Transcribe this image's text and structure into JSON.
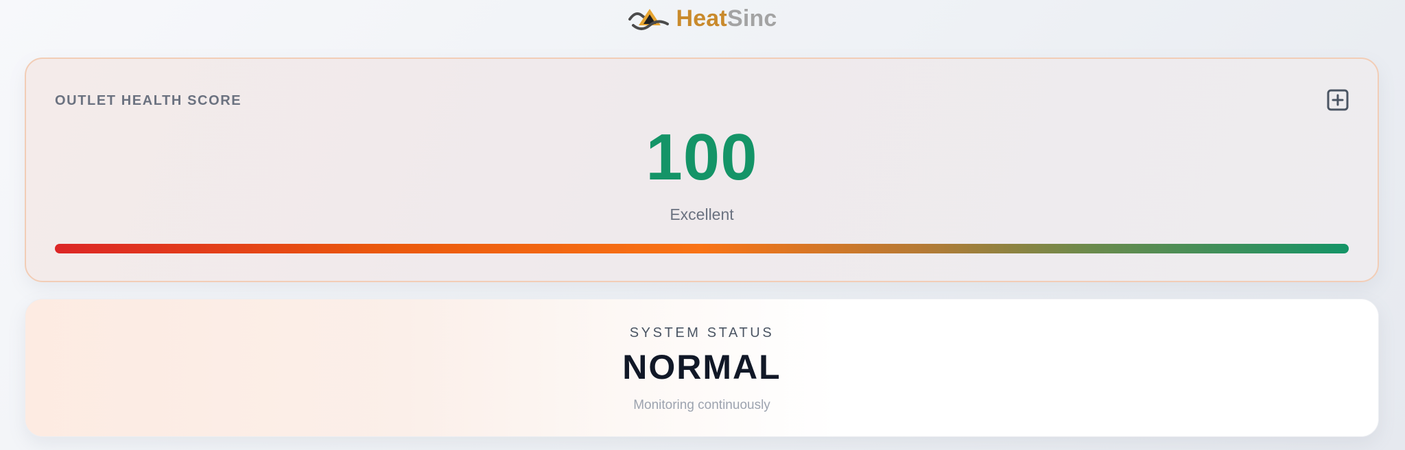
{
  "brand": {
    "name_part1": "Heat",
    "name_part2": "Sinc",
    "logo_icon": "heatsinc-wave-triangle-logo",
    "colors": {
      "heat": "#c98a2c",
      "sinc": "#a3a3a3"
    }
  },
  "health": {
    "label": "OUTLET HEALTH SCORE",
    "score": "100",
    "rating": "Excellent",
    "score_fraction": 1.0,
    "expand_icon": "plus-square-icon",
    "colors": {
      "score": "#149467",
      "bar_start": "#dc2626",
      "bar_mid": "#f97316",
      "bar_end": "#149467"
    }
  },
  "status": {
    "label": "SYSTEM STATUS",
    "value": "NORMAL",
    "subtitle": "Monitoring continuously"
  }
}
